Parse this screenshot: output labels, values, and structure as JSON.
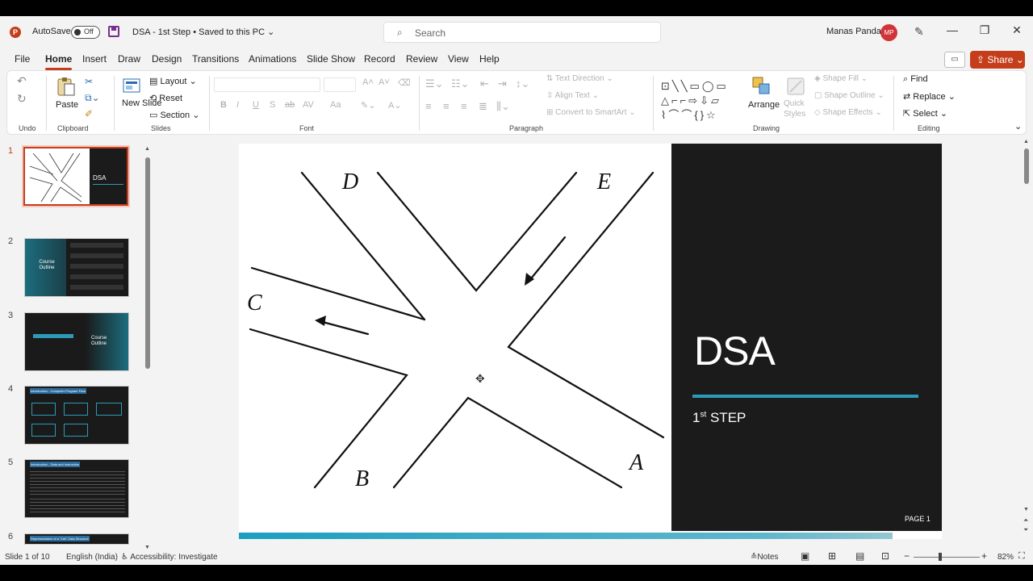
{
  "titlebar": {
    "app_icon_letter": "P",
    "autosave_label": "AutoSave",
    "autosave_state": "Off",
    "doc_title": "DSA - 1st Step • Saved to this PC ⌄",
    "search_placeholder": "Search",
    "username": "Manas Panda",
    "avatar_initials": "MP"
  },
  "tabs": [
    "File",
    "Home",
    "Insert",
    "Draw",
    "Design",
    "Transitions",
    "Animations",
    "Slide Show",
    "Record",
    "Review",
    "View",
    "Help"
  ],
  "share_label": "Share",
  "ribbon": {
    "groups": {
      "undo": "Undo",
      "clipboard": "Clipboard",
      "slides": "Slides",
      "font": "Font",
      "paragraph": "Paragraph",
      "drawing": "Drawing",
      "editing": "Editing"
    },
    "paste": "Paste",
    "new_slide": "New Slide",
    "layout": "Layout",
    "reset": "Reset",
    "section": "Section",
    "text_direction": "Text Direction",
    "align_text": "Align Text",
    "convert_smartart": "Convert to SmartArt",
    "arrange": "Arrange",
    "quick_styles": "Quick Styles",
    "shape_fill": "Shape Fill",
    "shape_outline": "Shape Outline",
    "shape_effects": "Shape Effects",
    "find": "Find",
    "replace": "Replace",
    "select": "Select",
    "font_buttons": [
      "B",
      "I",
      "U",
      "S",
      "ab",
      "AV",
      "Aa"
    ]
  },
  "thumbnails": [
    {
      "num": "1",
      "label": "DSA"
    },
    {
      "num": "2",
      "label": "Course Outline"
    },
    {
      "num": "3",
      "label": "Course Outline"
    },
    {
      "num": "4",
      "label": "Introduction - Computer Program Flow"
    },
    {
      "num": "5",
      "label": "Introduction - Data and Instruction"
    },
    {
      "num": "6",
      "label": "Representation of a \"List\" Data Structure"
    }
  ],
  "slide": {
    "title": "DSA",
    "subtitle_main": "1",
    "subtitle_sup": "st",
    "subtitle_rest": " STEP",
    "page": "PAGE 1",
    "junction_labels": {
      "a": "A",
      "b": "B",
      "c": "C",
      "d": "D",
      "e": "E"
    }
  },
  "status": {
    "slide_info": "Slide 1 of 10",
    "language": "English (India)",
    "accessibility": "Accessibility: Investigate",
    "notes": "Notes",
    "zoom": "82%"
  },
  "colors": {
    "accent": "#c43e1c",
    "teal": "#2b9bb8",
    "slide_dark": "#1b1b1b"
  }
}
